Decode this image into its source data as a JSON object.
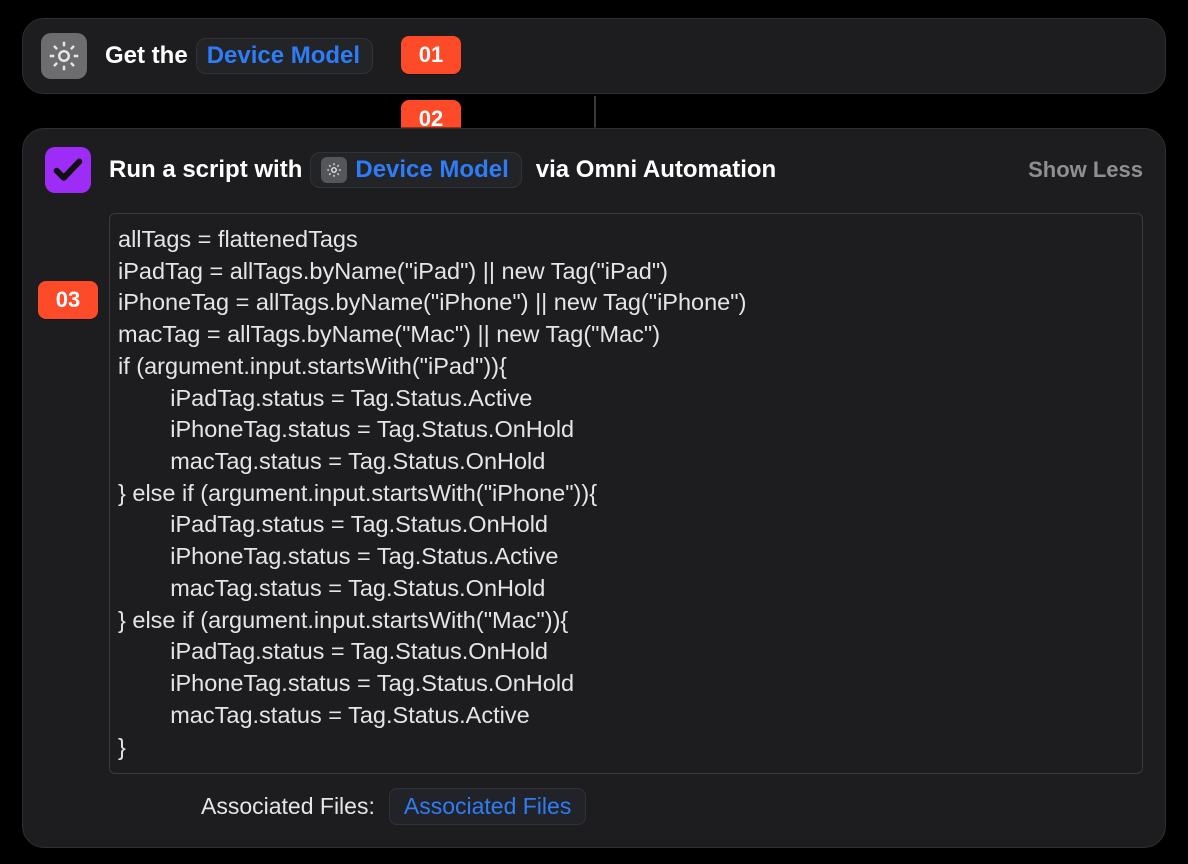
{
  "callouts": {
    "c1": "01",
    "c2": "02",
    "c3": "03"
  },
  "action1": {
    "prefix": "Get the",
    "token_label": "Device Model"
  },
  "action2": {
    "prefix": "Run a script with",
    "token_label": "Device Model",
    "suffix": "via Omni Automation",
    "toggle_label": "Show Less"
  },
  "script_lines": [
    "allTags = flattenedTags",
    "iPadTag = allTags.byName(\"iPad\") || new Tag(\"iPad\")",
    "iPhoneTag = allTags.byName(\"iPhone\") || new Tag(\"iPhone\")",
    "macTag = allTags.byName(\"Mac\") || new Tag(\"Mac\")",
    "if (argument.input.startsWith(\"iPad\")){",
    "\tiPadTag.status = Tag.Status.Active",
    "\tiPhoneTag.status = Tag.Status.OnHold",
    "\tmacTag.status = Tag.Status.OnHold",
    "} else if (argument.input.startsWith(\"iPhone\")){",
    "\tiPadTag.status = Tag.Status.OnHold",
    "\tiPhoneTag.status = Tag.Status.Active",
    "\tmacTag.status = Tag.Status.OnHold",
    "} else if (argument.input.startsWith(\"Mac\")){",
    "\tiPadTag.status = Tag.Status.OnHold",
    "\tiPhoneTag.status = Tag.Status.OnHold",
    "\tmacTag.status = Tag.Status.Active",
    "}"
  ],
  "associated": {
    "label": "Associated Files:",
    "token": "Associated Files"
  }
}
